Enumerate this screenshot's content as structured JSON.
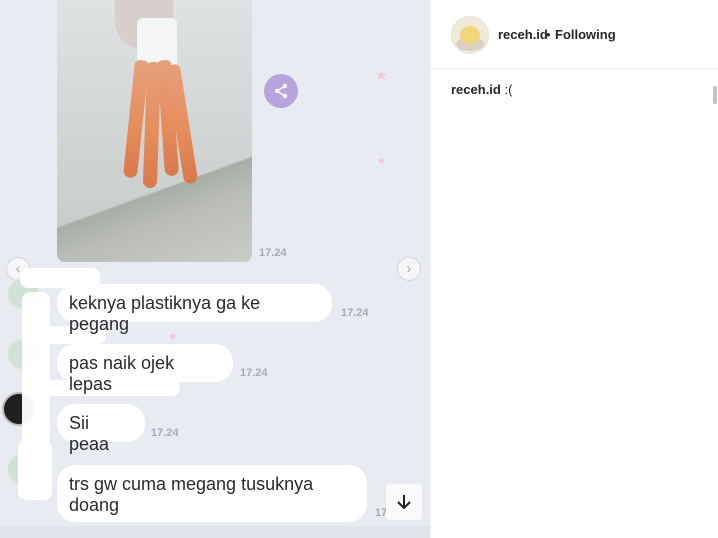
{
  "post": {
    "author": "receh.id",
    "follow_status": "Following",
    "separator": "•",
    "caption_text": ":("
  },
  "chat": {
    "image_timestamp": "17.24",
    "messages": [
      {
        "text": "keknya plastiknya ga ke pegang",
        "time": "17.24"
      },
      {
        "text": "pas naik ojek lepas",
        "time": "17.24"
      },
      {
        "text": "Sii peaa",
        "time": "17.24"
      },
      {
        "text": "trs gw cuma megang tusuknya doang",
        "time": "17"
      }
    ]
  },
  "icons": {
    "share": "share-icon",
    "prev": "chevron-left-icon",
    "next": "chevron-right-icon",
    "scroll_down": "arrow-down-icon"
  },
  "colors": {
    "chat_bg": "#e9ebf3",
    "share_button": "#b8a3de",
    "timestamp": "#a7a9b6"
  }
}
